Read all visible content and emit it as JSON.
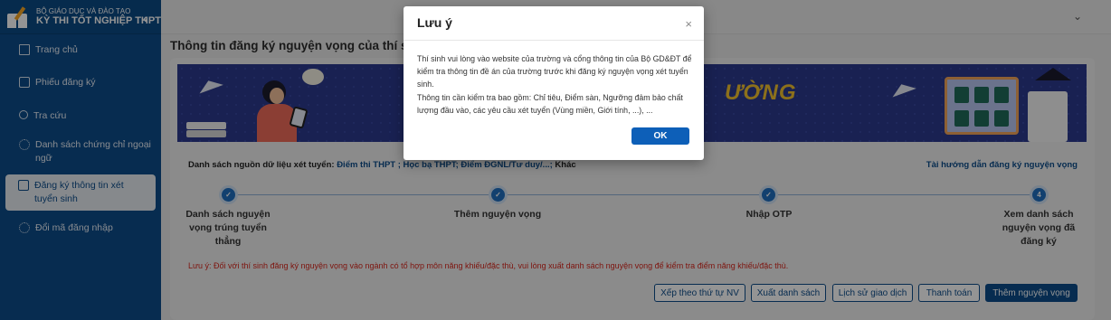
{
  "brand": {
    "line1": "BỘ GIÁO DỤC VÀ ĐÀO TẠO",
    "line2": "KỲ THI TỐT NGHIỆP THPT"
  },
  "sidebar": {
    "items": [
      {
        "label": "Trang chủ",
        "icon": "home-icon"
      },
      {
        "label": "Phiếu đăng ký",
        "icon": "document-icon"
      },
      {
        "label": "Tra cứu",
        "icon": "search-icon"
      },
      {
        "label": "Danh sách chứng chỉ ngoại ngữ",
        "icon": "gear-icon"
      },
      {
        "label": "Đăng ký thông tin xét tuyển sinh",
        "icon": "edit-icon",
        "active": true
      },
      {
        "label": "Đổi mã đăng nhập",
        "icon": "gear-icon"
      }
    ]
  },
  "main": {
    "title": "Thông tin đăng ký nguyện vọng của thí sinh",
    "banner_word": "ƯỜNG",
    "sources_label": "Danh sách nguồn dữ liệu xét tuyển:",
    "sources_links": "Điểm thi THPT ; Học bạ THPT; Điểm ĐGNL/Tư duy/...;",
    "sources_other": "Khác",
    "guide_link": "Tài hướng dẫn đăng ký nguyện vọng",
    "steps": [
      {
        "marker": "✓",
        "label": "Danh sách nguyện vọng trúng tuyển thẳng"
      },
      {
        "marker": "✓",
        "label": "Thêm nguyện vọng"
      },
      {
        "marker": "✓",
        "label": "Nhập OTP"
      },
      {
        "marker": "4",
        "label": "Xem danh sách nguyện vọng đã đăng ký"
      }
    ],
    "note": "Lưu ý: Đối với thí sinh đăng ký nguyện vọng vào ngành có tổ hợp môn năng khiếu/đặc thù, vui lòng xuất danh sách nguyện vọng để kiểm tra điểm năng khiếu/đặc thù.",
    "buttons": {
      "sort": "Xếp theo thứ tự NV",
      "export": "Xuất danh sách",
      "history": "Lịch sử giao dịch",
      "pay": "Thanh toán",
      "add": "Thêm nguyện vọng"
    }
  },
  "modal": {
    "title": "Lưu ý",
    "close": "×",
    "body_line1": "Thí sinh vui lòng vào website của trường và cổng thông tin của Bộ GD&ĐT để kiểm tra thông tin đề án của trường trước khi đăng ký nguyện vọng xét tuyển sinh.",
    "body_line2": "Thông tin cần kiểm tra bao gồm: Chỉ tiêu, Điểm sàn, Ngưỡng đảm bảo chất lượng đầu vào, các yêu cầu xét tuyển (Vùng miền, Giới tính, ...), ...",
    "ok": "OK"
  },
  "colors": {
    "primary": "#0d4d8b",
    "accent": "#0d5fb8",
    "warning": "#d9261c"
  }
}
